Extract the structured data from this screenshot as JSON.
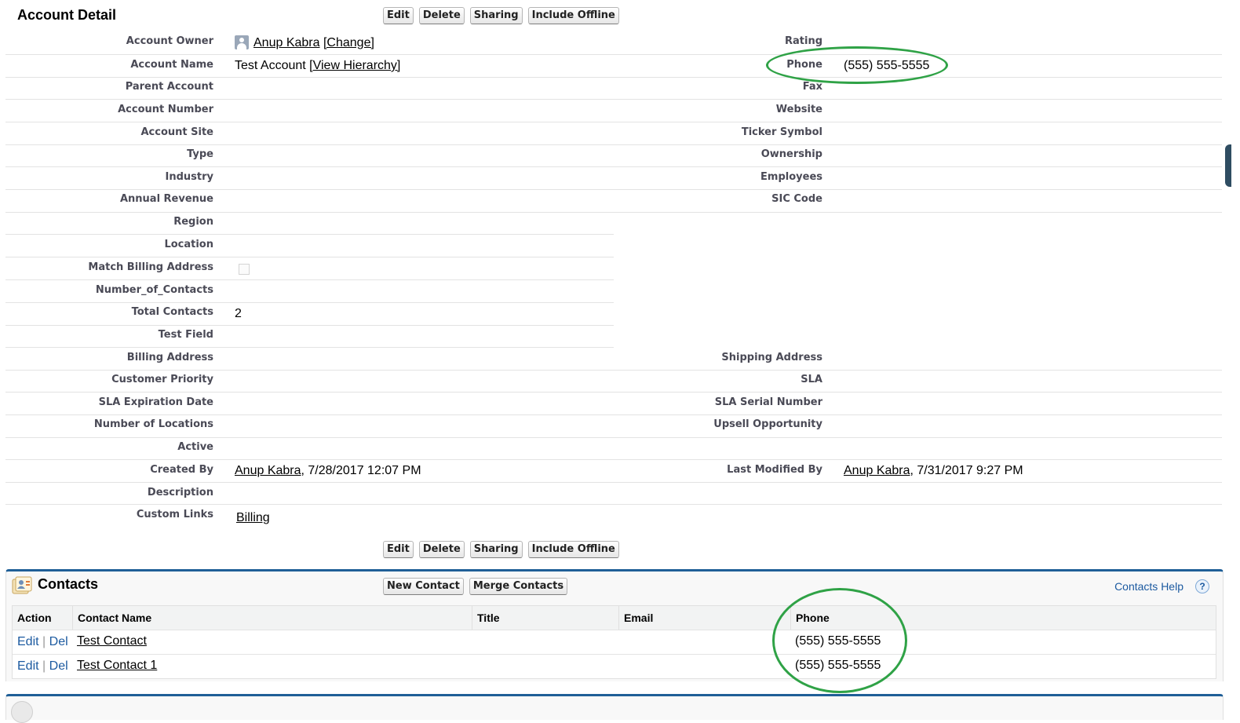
{
  "detail": {
    "title": "Account Detail",
    "buttons": [
      "Edit",
      "Delete",
      "Sharing",
      "Include Offline"
    ],
    "left_fields": [
      {
        "label": "Account Owner",
        "value": ""
      },
      {
        "label": "Account Name",
        "value": ""
      },
      {
        "label": "Parent Account",
        "value": ""
      },
      {
        "label": "Account Number",
        "value": ""
      },
      {
        "label": "Account Site",
        "value": ""
      },
      {
        "label": "Type",
        "value": ""
      },
      {
        "label": "Industry",
        "value": ""
      },
      {
        "label": "Annual Revenue",
        "value": ""
      },
      {
        "label": "Region",
        "value": ""
      },
      {
        "label": "Location",
        "value": ""
      },
      {
        "label": "Match Billing Address",
        "value": ""
      },
      {
        "label": "Number_of_Contacts",
        "value": ""
      },
      {
        "label": "Total Contacts",
        "value": "2"
      },
      {
        "label": "Test Field",
        "value": ""
      },
      {
        "label": "Billing Address",
        "value": ""
      },
      {
        "label": "Customer Priority",
        "value": ""
      },
      {
        "label": "SLA Expiration Date",
        "value": ""
      },
      {
        "label": "Number of Locations",
        "value": ""
      },
      {
        "label": "Active",
        "value": ""
      },
      {
        "label": "Created By",
        "value": ""
      },
      {
        "label": "Description",
        "value": ""
      },
      {
        "label": "Custom Links",
        "value": ""
      }
    ],
    "right_fields": [
      {
        "label": "Rating",
        "value": ""
      },
      {
        "label": "Phone",
        "value": "(555) 555-5555"
      },
      {
        "label": "Fax",
        "value": ""
      },
      {
        "label": "Website",
        "value": ""
      },
      {
        "label": "Ticker Symbol",
        "value": ""
      },
      {
        "label": "Ownership",
        "value": ""
      },
      {
        "label": "Employees",
        "value": ""
      },
      {
        "label": "SIC Code",
        "value": ""
      },
      {
        "label": "Shipping Address",
        "value": ""
      },
      {
        "label": "SLA",
        "value": ""
      },
      {
        "label": "SLA Serial Number",
        "value": ""
      },
      {
        "label": "Upsell Opportunity",
        "value": ""
      },
      {
        "label": "Last Modified By",
        "value": ""
      }
    ],
    "owner_name": "Anup Kabra",
    "owner_change": "[Change]",
    "account_name": "Test Account",
    "view_hierarchy": "[View Hierarchy]",
    "created_by_name": "Anup Kabra",
    "created_by_date": ", 7/28/2017 12:07 PM",
    "modified_by_name": "Anup Kabra",
    "modified_by_date": ", 7/31/2017 9:27 PM",
    "custom_link": "Billing"
  },
  "contacts": {
    "title": "Contacts",
    "buttons": [
      "New Contact",
      "Merge Contacts"
    ],
    "help": "Contacts Help",
    "help_symbol": "?",
    "columns": [
      "Action",
      "Contact Name",
      "Title",
      "Email",
      "Phone"
    ],
    "action_edit": "Edit",
    "action_sep": "|",
    "action_del": "Del",
    "rows": [
      {
        "name": "Test Contact",
        "phone": "(555) 555-5555"
      },
      {
        "name": "Test Contact 1",
        "phone": "(555) 555-5555"
      }
    ]
  },
  "colors": {
    "accent_green": "#2fa246",
    "panel_blue": "#1f5f97",
    "link_blue": "#1c5aa0"
  }
}
